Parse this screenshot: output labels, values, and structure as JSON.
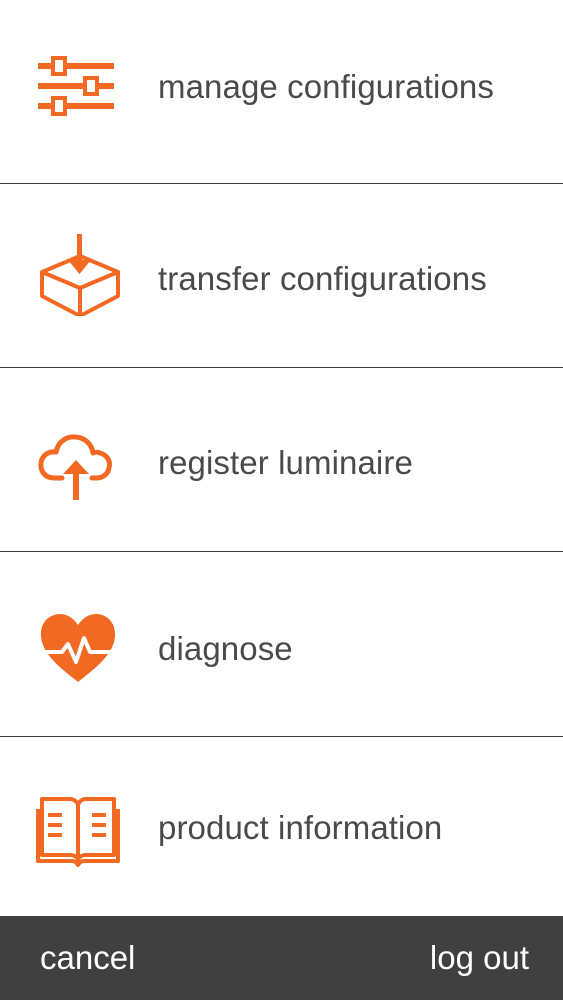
{
  "menu": {
    "items": [
      {
        "label": "manage configurations",
        "icon": "sliders-icon"
      },
      {
        "label": "transfer configurations",
        "icon": "box-download-icon"
      },
      {
        "label": "register luminaire",
        "icon": "cloud-upload-icon"
      },
      {
        "label": "diagnose",
        "icon": "heart-pulse-icon"
      },
      {
        "label": "product information",
        "icon": "book-icon"
      }
    ]
  },
  "bottom_bar": {
    "cancel_label": "cancel",
    "logout_label": "log out"
  },
  "colors": {
    "accent": "#f26a21",
    "text": "#4a4a4a",
    "divider": "#3c3c3c",
    "bottom_bar": "#404040",
    "bottom_bar_text": "#ffffff"
  }
}
